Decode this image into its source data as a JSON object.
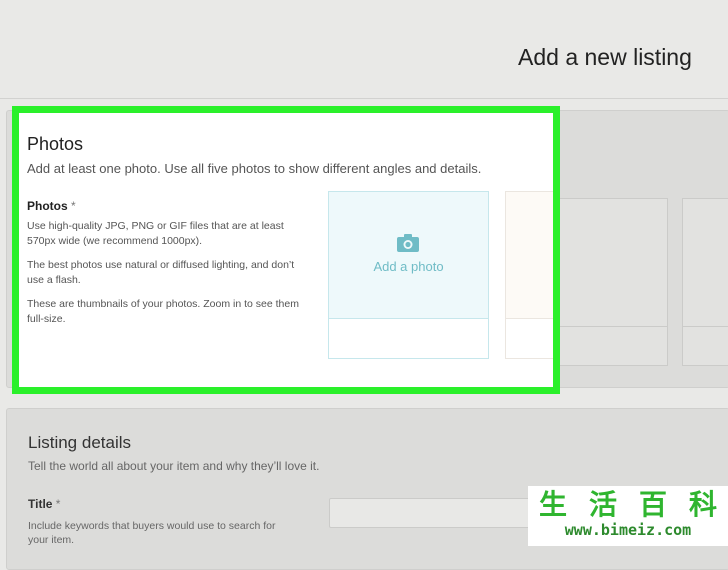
{
  "page": {
    "title": "Add a new listing"
  },
  "photos": {
    "heading": "Photos",
    "subtitle": "Add at least one photo. Use all five photos to show different angles and details.",
    "field_label": "Photos",
    "required_mark": "*",
    "help": [
      "Use high-quality JPG, PNG or GIF files that are at least 570px wide (we recommend 1000px).",
      "The best photos use natural or diffused lighting, and don’t use a flash.",
      "These are thumbnails of your photos. Zoom in to see them full-size."
    ],
    "add_photo_label": "Add a photo",
    "icon": "camera-icon"
  },
  "details": {
    "heading": "Listing details",
    "subtitle": "Tell the world all about your item and why they’ll love it.",
    "title_label": "Title",
    "required_mark": "*",
    "title_help": "Include keywords that buyers would use to search for your item."
  },
  "watermark": {
    "chars": [
      "生",
      "活",
      "百",
      "科"
    ],
    "url": "www.bimeiz.com"
  },
  "colors": {
    "highlight": "#2af02a",
    "accent": "#6fbcc6",
    "watermark": "#2fb52f"
  }
}
